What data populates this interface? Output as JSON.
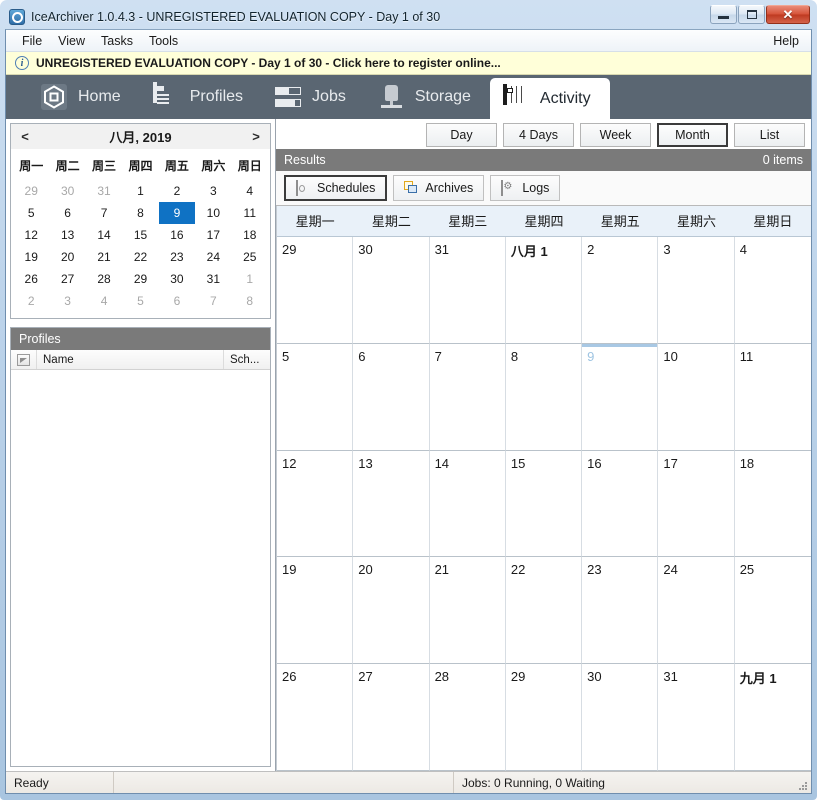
{
  "window": {
    "title": "IceArchiver 1.0.4.3 - UNREGISTERED EVALUATION COPY - Day 1 of 30",
    "app_icon": "app-icon",
    "buttons": {
      "minimize": "minimize-button",
      "maximize": "maximize-button",
      "close": "close-button",
      "close_glyph": "✕"
    }
  },
  "menubar": {
    "items": [
      {
        "label": "File"
      },
      {
        "label": "View"
      },
      {
        "label": "Tasks"
      },
      {
        "label": "Tools"
      }
    ],
    "help": "Help"
  },
  "nagbar": {
    "icon": "info-icon",
    "icon_glyph": "i",
    "text": "UNREGISTERED EVALUATION COPY - Day 1 of 30 - Click here to register online...",
    "background": "#ffffd9"
  },
  "ribbon": {
    "background": "#5a6672",
    "tabs": [
      {
        "label": "Home",
        "icon": "hexagon-icon",
        "active": false
      },
      {
        "label": "Profiles",
        "icon": "document-icon",
        "active": false
      },
      {
        "label": "Jobs",
        "icon": "bars-icon",
        "active": false
      },
      {
        "label": "Storage",
        "icon": "storage-device-icon",
        "active": false
      },
      {
        "label": "Activity",
        "icon": "calendar-icon",
        "active": true
      }
    ]
  },
  "mini_calendar": {
    "prev_label": "<",
    "next_label": ">",
    "title": "八月, 2019",
    "weekdays": [
      "周一",
      "周二",
      "周三",
      "周四",
      "周五",
      "周六",
      "周日"
    ],
    "selected_day": 9,
    "selected_color": "#0f72c4",
    "days": [
      {
        "n": "29",
        "other": true
      },
      {
        "n": "30",
        "other": true
      },
      {
        "n": "31",
        "other": true
      },
      {
        "n": "1",
        "other": false
      },
      {
        "n": "2",
        "other": false
      },
      {
        "n": "3",
        "other": false
      },
      {
        "n": "4",
        "other": false
      },
      {
        "n": "5",
        "other": false
      },
      {
        "n": "6",
        "other": false
      },
      {
        "n": "7",
        "other": false
      },
      {
        "n": "8",
        "other": false
      },
      {
        "n": "9",
        "other": false,
        "selected": true
      },
      {
        "n": "10",
        "other": false
      },
      {
        "n": "11",
        "other": false
      },
      {
        "n": "12",
        "other": false
      },
      {
        "n": "13",
        "other": false
      },
      {
        "n": "14",
        "other": false
      },
      {
        "n": "15",
        "other": false
      },
      {
        "n": "16",
        "other": false
      },
      {
        "n": "17",
        "other": false
      },
      {
        "n": "18",
        "other": false
      },
      {
        "n": "19",
        "other": false
      },
      {
        "n": "20",
        "other": false
      },
      {
        "n": "21",
        "other": false
      },
      {
        "n": "22",
        "other": false
      },
      {
        "n": "23",
        "other": false
      },
      {
        "n": "24",
        "other": false
      },
      {
        "n": "25",
        "other": false
      },
      {
        "n": "26",
        "other": false
      },
      {
        "n": "27",
        "other": false
      },
      {
        "n": "28",
        "other": false
      },
      {
        "n": "29",
        "other": false
      },
      {
        "n": "30",
        "other": false
      },
      {
        "n": "31",
        "other": false
      },
      {
        "n": "1",
        "other": true
      },
      {
        "n": "2",
        "other": true
      },
      {
        "n": "3",
        "other": true
      },
      {
        "n": "4",
        "other": true
      },
      {
        "n": "5",
        "other": true
      },
      {
        "n": "6",
        "other": true
      },
      {
        "n": "7",
        "other": true
      },
      {
        "n": "8",
        "other": true
      }
    ]
  },
  "profiles_panel": {
    "caption": "Profiles",
    "columns": [
      {
        "label": "",
        "name": "sort-indicator-column"
      },
      {
        "label": "Name",
        "name": "name-column"
      },
      {
        "label": "Sch...",
        "name": "schedule-column"
      }
    ],
    "rows": []
  },
  "view_modes": {
    "buttons": [
      {
        "label": "Day",
        "selected": false
      },
      {
        "label": "4 Days",
        "selected": false
      },
      {
        "label": "Week",
        "selected": false
      },
      {
        "label": "Month",
        "selected": true
      },
      {
        "label": "List",
        "selected": false
      }
    ]
  },
  "results_panel": {
    "caption": "Results",
    "count": "0 items"
  },
  "sub_tabs": [
    {
      "label": "Schedules",
      "icon": "schedule-document-icon",
      "selected": true
    },
    {
      "label": "Archives",
      "icon": "archive-box-icon",
      "selected": false
    },
    {
      "label": "Logs",
      "icon": "log-gear-icon",
      "selected": false
    }
  ],
  "calendar": {
    "weekdays": [
      "星期一",
      "星期二",
      "星期三",
      "星期四",
      "星期五",
      "星期六",
      "星期日"
    ],
    "weekday_bg": "#e9f1f9",
    "today_marker_color": "#a8c8e4",
    "cells": [
      {
        "label": "29"
      },
      {
        "label": "30"
      },
      {
        "label": "31"
      },
      {
        "label": "八月 1",
        "bold": true
      },
      {
        "label": "2"
      },
      {
        "label": "3"
      },
      {
        "label": "4"
      },
      {
        "label": "5"
      },
      {
        "label": "6"
      },
      {
        "label": "7"
      },
      {
        "label": "8"
      },
      {
        "label": "9",
        "today": true
      },
      {
        "label": "10"
      },
      {
        "label": "11"
      },
      {
        "label": "12"
      },
      {
        "label": "13"
      },
      {
        "label": "14"
      },
      {
        "label": "15"
      },
      {
        "label": "16"
      },
      {
        "label": "17"
      },
      {
        "label": "18"
      },
      {
        "label": "19"
      },
      {
        "label": "20"
      },
      {
        "label": "21"
      },
      {
        "label": "22"
      },
      {
        "label": "23"
      },
      {
        "label": "24"
      },
      {
        "label": "25"
      },
      {
        "label": "26"
      },
      {
        "label": "27"
      },
      {
        "label": "28"
      },
      {
        "label": "29"
      },
      {
        "label": "30"
      },
      {
        "label": "31"
      },
      {
        "label": "九月 1",
        "bold": true
      }
    ]
  },
  "statusbar": {
    "ready": "Ready",
    "middle": "",
    "jobs": "Jobs: 0 Running, 0 Waiting"
  }
}
